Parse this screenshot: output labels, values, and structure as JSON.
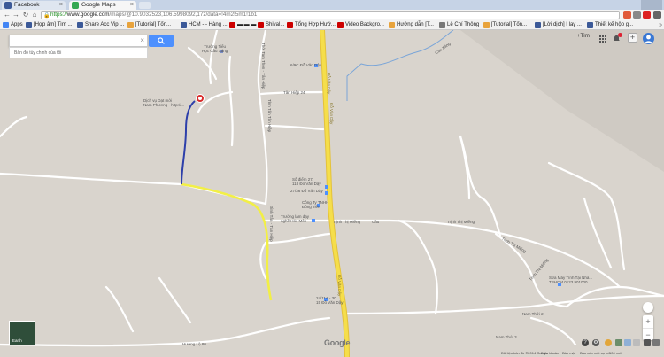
{
  "browser": {
    "tabs": [
      {
        "title": "Facebook",
        "active": false
      },
      {
        "title": "Google Maps",
        "active": true
      }
    ],
    "url": {
      "scheme": "https://",
      "host": "www.google.com",
      "path": "/maps/@10.9032523,106.5998092,17z/data=!4m2!5m1!1b1"
    },
    "bookmarks": [
      "Apps",
      "[Hợp âm] Tìm ...",
      "Share Acc Vip ...",
      "[Tutorial] Tốn...",
      "HCM - - Hàng ...",
      "▬ ▬ ▬",
      "Shival...",
      "Tổng Hợp Hướ...",
      "Video Backgro...",
      "Hướng dẫn [T...",
      "Lê Chí Thông",
      "[Tutorial] Tốn...",
      "[Lời dịch] I lay ...",
      "Thiết kế hộp g..."
    ],
    "colors": {
      "tabbar": "#c6d3e6",
      "accent": "#4d90fe"
    }
  },
  "maps": {
    "search": {
      "placeholder": "",
      "value": ""
    },
    "suggestion": "Bản đồ tùy chỉnh của tôi",
    "plus_you": "+Tìm",
    "notification_icon": "bell-icon",
    "earth_label": "Earth",
    "google_logo": "Google",
    "footer": {
      "copyright": "Dữ liệu bản đồ ©2014 Google",
      "terms": "Điều khoản",
      "privacy": "Bảo mật",
      "feedback": "Báo cáo một sự cố",
      "scale": "100 mét"
    },
    "roads": {
      "main_a": "Đỗ Văn Dậy",
      "main_b": "Đỗ Văn Dậy",
      "cau_xang": "Cầu Xáng",
      "trinh_thi_mieng_a": "Trịnh Thị Miếng",
      "trinh_thi_mieng_b": "Trịnh Thị Miếng",
      "trinh_thi_mieng_c": "Trịnh Thị Miếng",
      "trinh_thi_mieng_d": "Trịnh Thị Miếng",
      "huong_lo_80": "Hương Lộ 80",
      "tan_hiep_24": "Tân Hiệp 24",
      "thoi_tam_thon": "Thới Tam Thôn - Tân Hiệp",
      "tinh_tan_tan_hiep": "Tỉnh Tân Tân Hiệp",
      "dinh_tan": "Đình Tân - Tân Hiệp",
      "nam_thoi_2": "Nam Thới 2",
      "nam_thoi_3": "Nam Thới 3",
      "cau_label": "Cầu"
    },
    "places": {
      "truong_tieu_hoc": "Trường Tiểu\nHọc Cầu Xáng",
      "dich_vu": "Dịch vụ Dạt mới\nNam Phương - http://...",
      "dai_lo_6": "6/9C Đỗ Văn Dậy",
      "diem_27": "Số điểm 27/\n118 Đỗ Văn Dậy",
      "diem_27b": "27/36 Đỗ Văn Dậy",
      "cong_ty": "Công Ty TNHH\nĐông Tiến",
      "truong_day_nghe": "Trường làm dạy\nnghề Hóc Môn",
      "diem_24": "24/11A - 30\n15 Đỗ Văn Dậy",
      "sua_may": "Sửa Máy Tính Tại Nhà...\nTPHCM 0123 901000"
    }
  }
}
